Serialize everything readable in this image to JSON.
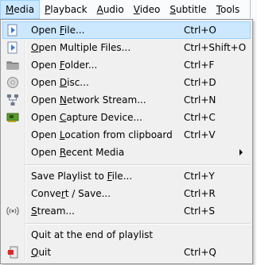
{
  "menubar": {
    "items": [
      {
        "label": "Media",
        "mnemonic": "M",
        "rest": "edia",
        "active": true
      },
      {
        "label": "Playback",
        "mnemonic": "P",
        "rest": "layback"
      },
      {
        "label": "Audio",
        "mnemonic": "A",
        "rest": "udio"
      },
      {
        "label": "Video",
        "mnemonic": "V",
        "rest": "ideo"
      },
      {
        "label": "Subtitle",
        "mnemonic": "S",
        "rest": "ubtitle"
      },
      {
        "label": "Tools",
        "mnemonic": "T",
        "rest": "ools"
      }
    ]
  },
  "media_menu": {
    "items": [
      {
        "pre": "Open ",
        "mnemonic": "F",
        "post": "ile...",
        "shortcut": "Ctrl+O",
        "icon": "play-file-icon",
        "highlighted": true
      },
      {
        "pre": "",
        "mnemonic": "O",
        "post": "pen Multiple Files...",
        "shortcut": "Ctrl+Shift+O",
        "icon": "play-file-icon"
      },
      {
        "pre": "Open ",
        "mnemonic": "F",
        "post": "older...",
        "shortcut": "Ctrl+F",
        "icon": "folder-icon"
      },
      {
        "pre": "Open ",
        "mnemonic": "D",
        "post": "isc...",
        "shortcut": "Ctrl+D",
        "icon": "disc-icon"
      },
      {
        "pre": "Open ",
        "mnemonic": "N",
        "post": "etwork Stream...",
        "shortcut": "Ctrl+N",
        "icon": "network-icon"
      },
      {
        "pre": "Open ",
        "mnemonic": "C",
        "post": "apture Device...",
        "shortcut": "Ctrl+C",
        "icon": "capture-card-icon"
      },
      {
        "pre": "Open ",
        "mnemonic": "L",
        "post": "ocation from clipboard",
        "shortcut": "Ctrl+V",
        "icon": ""
      },
      {
        "pre": "Open ",
        "mnemonic": "R",
        "post": "ecent Media",
        "shortcut": "",
        "icon": "",
        "submenu": true
      },
      {
        "pre": "Save Playlist to ",
        "mnemonic": "F",
        "post": "ile...",
        "shortcut": "Ctrl+Y",
        "icon": ""
      },
      {
        "pre": "Conve",
        "mnemonic": "r",
        "post": "t / Save...",
        "shortcut": "Ctrl+R",
        "icon": ""
      },
      {
        "pre": "",
        "mnemonic": "S",
        "post": "tream...",
        "shortcut": "Ctrl+S",
        "icon": "stream-icon"
      },
      {
        "pre": "Quit at the end of playlist",
        "mnemonic": "",
        "post": "",
        "shortcut": "",
        "icon": ""
      },
      {
        "pre": "",
        "mnemonic": "Q",
        "post": "uit",
        "shortcut": "Ctrl+Q",
        "icon": "quit-icon"
      }
    ]
  },
  "colors": {
    "highlight": "#cce8ff",
    "highlight_border": "#99d1ff",
    "menu_bg": "#f0f0f0",
    "icon_blue": "#3b7bd4"
  }
}
